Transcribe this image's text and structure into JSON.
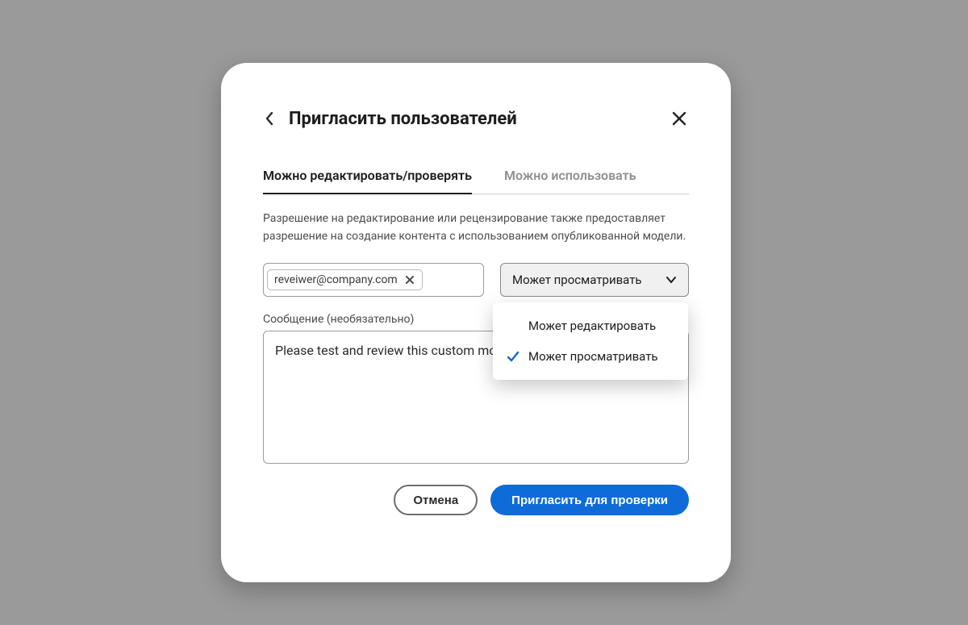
{
  "dialog": {
    "title": "Пригласить пользователей"
  },
  "tabs": {
    "edit_review": "Можно редактировать/проверять",
    "can_use": "Можно использовать"
  },
  "description": "Разрешение на редактирование или рецензирование также предоставляет разрешение на создание контента с использованием опубликованной модели.",
  "recipients": {
    "chip0": "reveiwer@company.com"
  },
  "permission_select": {
    "selected_label": "Может просматривать",
    "options": {
      "edit": "Может редактировать",
      "view": "Может просматривать"
    }
  },
  "message": {
    "label": "Сообщение (необязательно)",
    "value": "Please test and review this custom model developed for the team."
  },
  "actions": {
    "cancel": "Отмена",
    "invite": "Пригласить для проверки"
  }
}
